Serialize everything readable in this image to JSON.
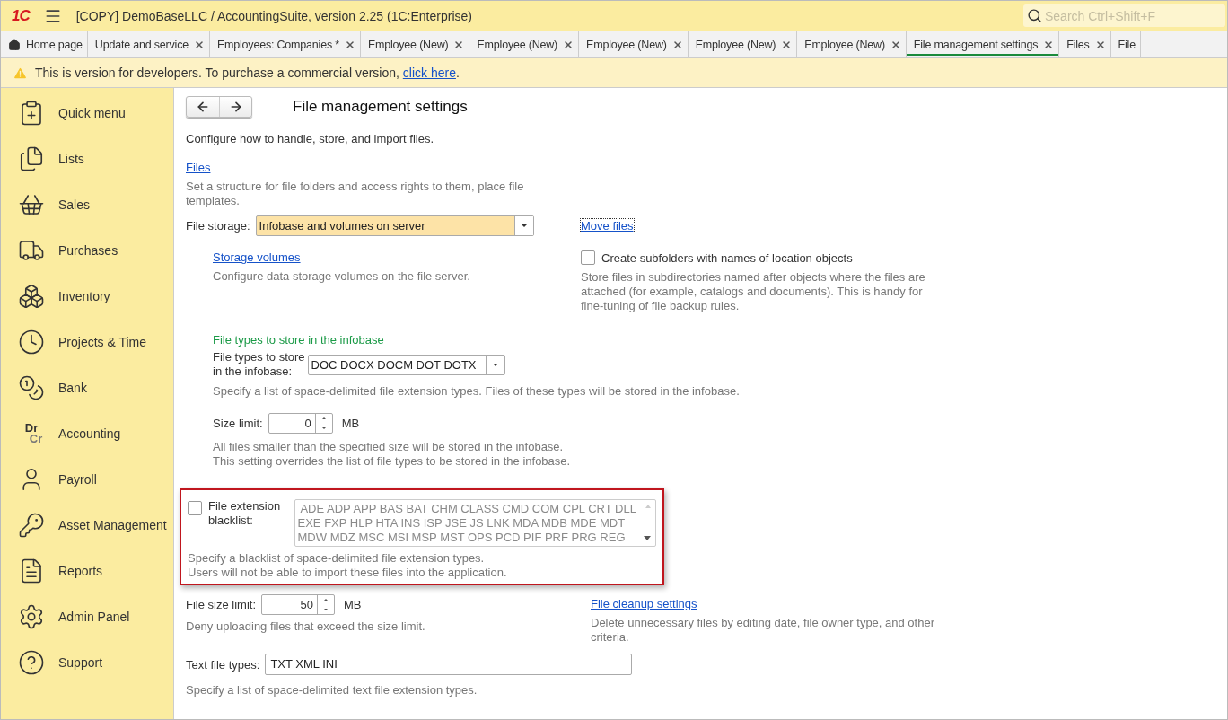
{
  "app": {
    "logo": "1С",
    "title": "[COPY] DemoBaseLLC / AccountingSuite, version 2.25  (1C:Enterprise)",
    "search": {
      "placeholder": "Search Ctrl+Shift+F"
    }
  },
  "tabs": [
    {
      "label": "Home page",
      "selected": false,
      "closable": false,
      "home": true
    },
    {
      "label": "Update and service",
      "selected": false,
      "closable": true
    },
    {
      "label": "Employees: Companies *",
      "selected": false,
      "closable": true
    },
    {
      "label": "Employee (New)",
      "selected": false,
      "closable": true
    },
    {
      "label": "Employee (New)",
      "selected": false,
      "closable": true
    },
    {
      "label": "Employee (New)",
      "selected": false,
      "closable": true
    },
    {
      "label": "Employee (New)",
      "selected": false,
      "closable": true
    },
    {
      "label": "Employee (New)",
      "selected": false,
      "closable": true
    },
    {
      "label": "File management settings",
      "selected": true,
      "closable": true
    },
    {
      "label": "Files",
      "selected": false,
      "closable": true
    },
    {
      "label": "File",
      "selected": false,
      "closable": false
    }
  ],
  "notice": {
    "text": "This is version for developers. To purchase a commercial version, ",
    "link": "click here",
    "end": "."
  },
  "sidebar": {
    "items": [
      {
        "label": "Quick menu"
      },
      {
        "label": "Lists"
      },
      {
        "label": "Sales"
      },
      {
        "label": "Purchases"
      },
      {
        "label": "Inventory"
      },
      {
        "label": "Projects & Time"
      },
      {
        "label": "Bank"
      },
      {
        "label": "Accounting",
        "monogram": [
          "Dr",
          "Cr"
        ]
      },
      {
        "label": "Payroll"
      },
      {
        "label": "Asset Management"
      },
      {
        "label": "Reports"
      },
      {
        "label": "Admin Panel"
      },
      {
        "label": "Support"
      }
    ]
  },
  "form": {
    "title": "File management settings",
    "description": "Configure how to handle, store, and import files.",
    "files_link": "Files",
    "files_hint": "Set a structure for file folders and access rights to them, place file templates.",
    "storage": {
      "label": "File storage:",
      "value": "Infobase and volumes on server"
    },
    "move_files": "Move files",
    "volumes_link": "Storage volumes",
    "volumes_hint": "Configure data storage volumes on the file server.",
    "subfolders": {
      "label": "Create subfolders with names of location objects",
      "checked": false,
      "hint": "Store files in subdirectories named after objects where the files are attached (for example, catalogs and documents). This is handy for fine-tuning of file backup rules."
    },
    "types_group": {
      "title": "File types to store in the infobase",
      "label_lines": [
        "File types to store",
        "in the infobase:"
      ],
      "value": "DOC DOCX DOCM DOT DOTX",
      "hint": "Specify a list of space-delimited file extension types. Files of these types will be stored in the infobase."
    },
    "size_limit": {
      "label": "Size limit:",
      "value": "0",
      "unit": "MB",
      "hint_lines": [
        "All files smaller than the specified size will be stored in the infobase.",
        "This setting overrides the list of file types to be stored in the infobase."
      ]
    },
    "blacklist": {
      "label_lines": [
        "File extension",
        "blacklist:"
      ],
      "checked": false,
      "value_lines": [
        " ADE ADP APP BAS BAT CHM CLASS CMD COM CPL CRT DLL",
        "EXE FXP HLP HTA INS ISP JSE JS LNK MDA MDB MDE MDT",
        "MDW MDZ MSC MSI MSP MST OPS PCD PIF PRF PRG REG"
      ],
      "hint_lines": [
        "Specify a blacklist of space-delimited file extension types.",
        "Users will not be able to import these files into the application."
      ]
    },
    "file_size_limit": {
      "label": "File size limit:",
      "value": "50",
      "unit": "MB",
      "hint": "Deny uploading files that exceed the size limit."
    },
    "cleanup": {
      "link": "File cleanup settings",
      "hint": "Delete unnecessary files by editing date, file owner type, and other criteria."
    },
    "text_types": {
      "label": "Text file types:",
      "value": "TXT XML INI",
      "hint": "Specify a list of space-delimited text file extension types."
    }
  }
}
